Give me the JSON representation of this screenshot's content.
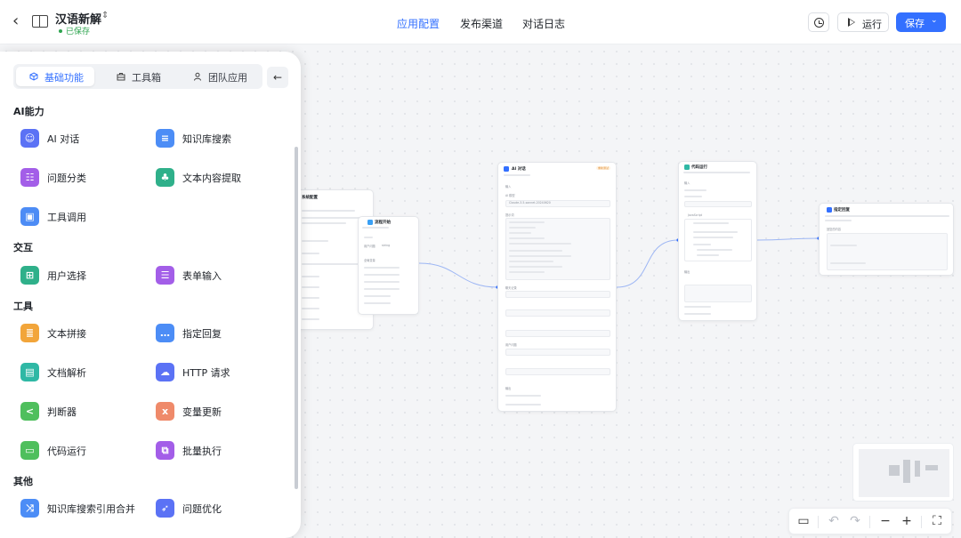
{
  "header": {
    "back_icon": "chevron-left-icon",
    "app_icon": "book-icon",
    "title": "汉语新解",
    "status": "已保存",
    "tabs": [
      "应用配置",
      "发布渠道",
      "对话日志"
    ],
    "active_tab": "应用配置",
    "run_label": "运行",
    "save_label": "保存",
    "accent": "#3370ff"
  },
  "panel": {
    "tabs": [
      "基础功能",
      "工具箱",
      "团队应用"
    ],
    "active_tab": "基础功能",
    "collapse_icon": "arrow-left-icon",
    "sections": [
      {
        "title": "AI能力",
        "items": [
          "AI 对话",
          "知识库搜索",
          "问题分类",
          "文本内容提取",
          "工具调用"
        ]
      },
      {
        "title": "交互",
        "items": [
          "用户选择",
          "表单输入"
        ]
      },
      {
        "title": "工具",
        "items": [
          "文本拼接",
          "指定回复",
          "文档解析",
          "HTTP 请求",
          "判断器",
          "变量更新",
          "代码运行",
          "批量执行"
        ]
      },
      {
        "title": "其他",
        "items": [
          "知识库搜索引用合并",
          "问题优化"
        ]
      }
    ]
  },
  "canvas": {
    "nodes": {
      "system": {
        "title": "系统配置"
      },
      "start": {
        "title": "流程开始",
        "output_label": "用户问题",
        "output_type": "string",
        "global_label": "全局变量"
      },
      "ai_chat": {
        "title": "AI 对话",
        "badge": "重新测试",
        "input_header": "输入",
        "model_label": "AI 模型",
        "model": "Claude-3-5-sonnet-20240620",
        "prompt_label": "提示词",
        "history_label": "聊天记录",
        "user_label": "用户问题",
        "output_header": "输出"
      },
      "code": {
        "title": "代码运行",
        "input_header": "输入",
        "output_header": "输出",
        "lang": "JavaScript"
      },
      "reply": {
        "title": "指定回复",
        "field_label": "回复的内容"
      }
    }
  },
  "toolbar": {
    "icons": [
      "layout-icon",
      "undo-icon",
      "redo-icon",
      "zoom-out-icon",
      "zoom-in-icon",
      "fit-view-icon"
    ]
  }
}
